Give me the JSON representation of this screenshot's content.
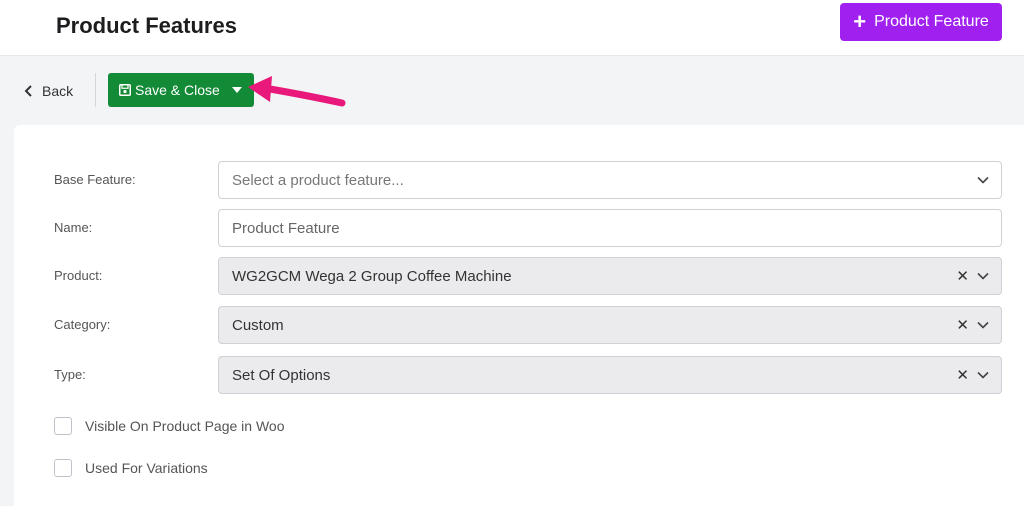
{
  "header": {
    "title": "Product Features",
    "add_button_label": "Product Feature"
  },
  "toolbar": {
    "back_label": "Back",
    "save_label": "Save & Close"
  },
  "form": {
    "base_feature": {
      "label": "Base Feature:",
      "placeholder": "Select a product feature..."
    },
    "name": {
      "label": "Name:",
      "placeholder": "Product Feature"
    },
    "product": {
      "label": "Product:",
      "value": "WG2GCM Wega 2 Group Coffee Machine"
    },
    "category": {
      "label": "Category:",
      "value": "Custom"
    },
    "type": {
      "label": "Type:",
      "value": "Set Of Options"
    },
    "visible_on_product_page": {
      "label": "Visible On Product Page in Woo",
      "checked": false
    },
    "used_for_variations": {
      "label": "Used For Variations",
      "checked": false
    }
  },
  "colors": {
    "accent_purple": "#a020f0",
    "save_green": "#138a36",
    "annotation_arrow": "#e8197a"
  }
}
